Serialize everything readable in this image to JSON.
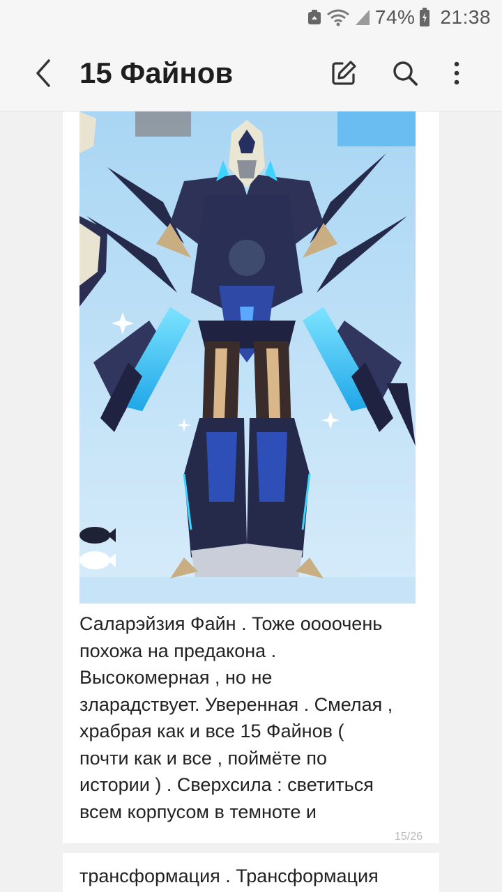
{
  "status_bar": {
    "battery_percent": "74%",
    "time": "21:38",
    "icons": [
      "recycle-notification-icon",
      "wifi-icon",
      "signal-icon",
      "battery-icon"
    ]
  },
  "app_bar": {
    "title": "15 Файнов",
    "actions": [
      "back-arrow-icon",
      "edit-icon",
      "search-icon",
      "more-vert-icon"
    ]
  },
  "post": {
    "image": "character-artwork",
    "caption": "Саларэйзия Файн . Тоже оооочень\nпохожа на предакона .\nВысокомерная , но не\nзларадствует. Уверенная .  Смелая ,\nхрабрая как и все 15 Файнов (\nпочти как и все , поймёте по\nистории ) . Сверхсила : светиться\nвсем корпусом в темноте и",
    "page_counter": "15/26"
  },
  "next_post": {
    "caption": "трансформация . Трансформация"
  },
  "colors": {
    "background": "#f1f1f1",
    "card": "#ffffff",
    "artwork_sky": "#bfe0f5",
    "armor_dark": "#262a4a",
    "glow_cyan": "#3ed4ff"
  }
}
